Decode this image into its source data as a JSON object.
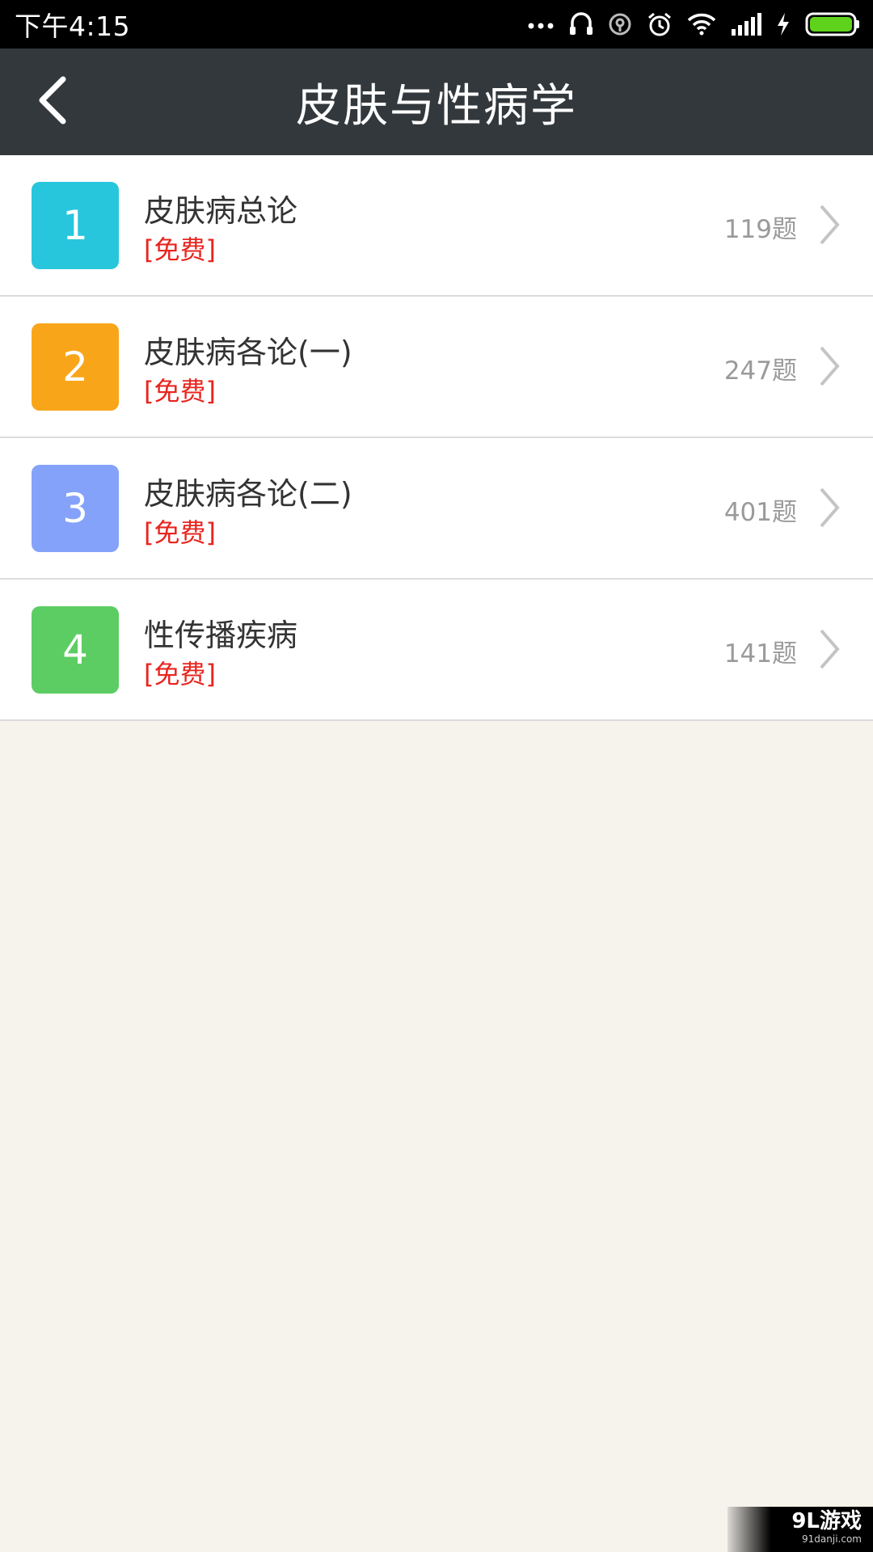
{
  "status_bar": {
    "time": "下午4:15",
    "icons": [
      "more-dots-icon",
      "headset-icon",
      "location-icon",
      "alarm-icon",
      "wifi-icon",
      "signal-icon",
      "charging-icon",
      "battery-icon"
    ],
    "battery_color": "#5fd31c"
  },
  "app_bar": {
    "title": "皮肤与性病学",
    "back_icon": "back-arrow-icon",
    "background": "#33383c"
  },
  "chapters": [
    {
      "number": "1",
      "title": "皮肤病总论",
      "tag": "[免费]",
      "count": "119题",
      "color": "#27c6dc"
    },
    {
      "number": "2",
      "title": "皮肤病各论(一)",
      "tag": "[免费]",
      "count": "247题",
      "color": "#f9a51a"
    },
    {
      "number": "3",
      "title": "皮肤病各论(二)",
      "tag": "[免费]",
      "count": "401题",
      "color": "#85a2fa"
    },
    {
      "number": "4",
      "title": "性传播疾病",
      "tag": "[免费]",
      "count": "141题",
      "color": "#5ccd62"
    }
  ],
  "watermark": {
    "logo": "9L游戏",
    "site": "91danji.com"
  }
}
